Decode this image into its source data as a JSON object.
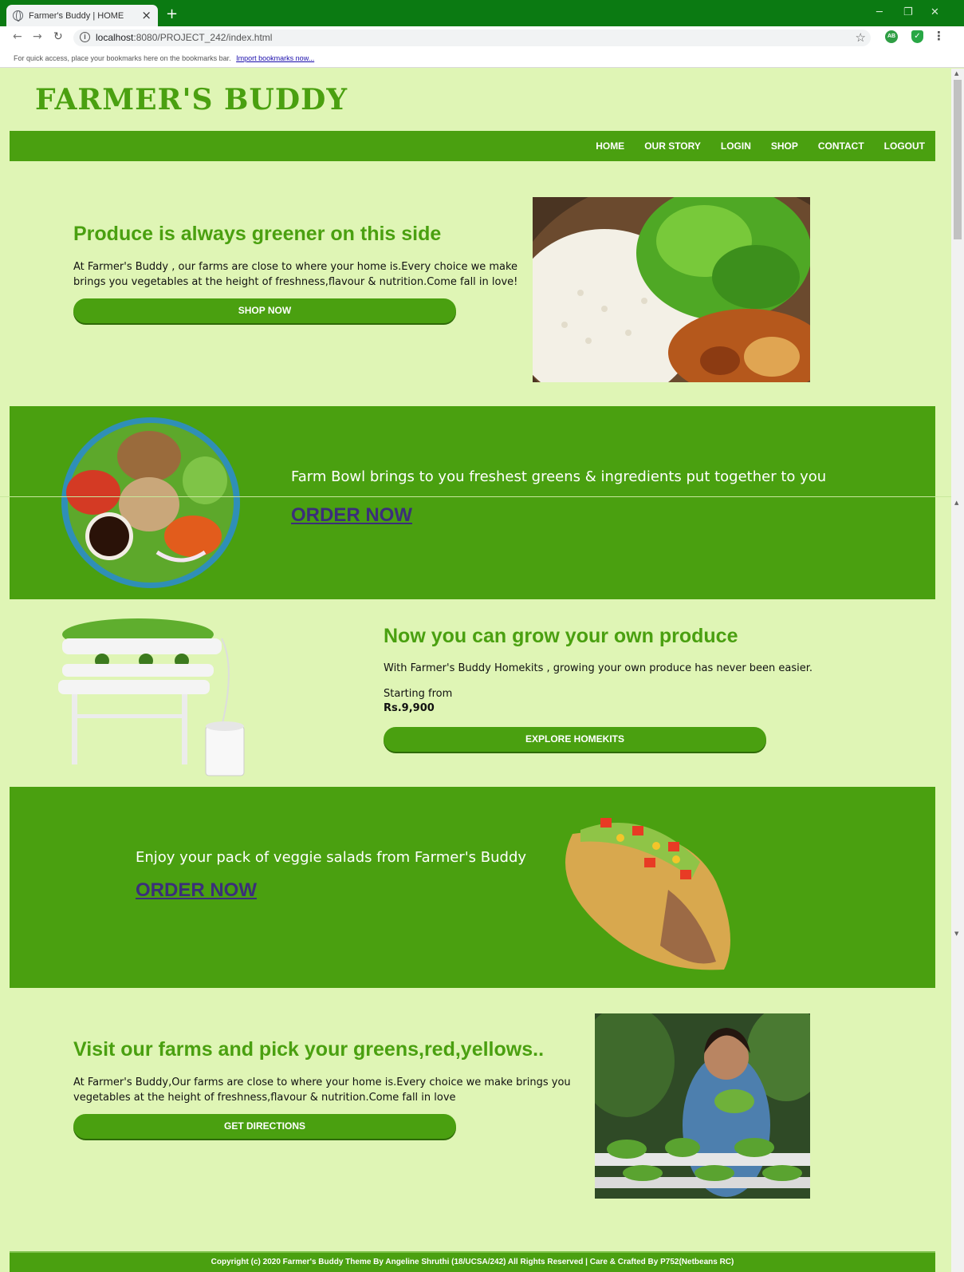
{
  "browser": {
    "tab_title": "Farmer's Buddy | HOME",
    "url_host": "localhost",
    "url_rest": ":8080/PROJECT_242/index.html",
    "bookmarks_text": "For quick access, place your bookmarks here on the bookmarks bar.",
    "bookmarks_link": "Import bookmarks now...",
    "ext1_label": "AB",
    "ext2_label": "✓"
  },
  "site": {
    "logo": "FARMER'S BUDDY",
    "nav": [
      "HOME",
      "OUR STORY",
      "LOGIN",
      "SHOP",
      "CONTACT",
      "LOGOUT"
    ]
  },
  "hero": {
    "heading": "Produce is always greener on this side",
    "text": "At Farmer's Buddy , our farms are close to where your home is.Every choice we make brings you vegetables at the height of freshness,flavour & nutrition.Come fall in love!",
    "button": "SHOP NOW"
  },
  "farm_bowl": {
    "text": "Farm Bowl brings to you freshest greens & ingredients put together to you",
    "link": "ORDER NOW"
  },
  "homekits": {
    "heading": "Now you can grow your own produce",
    "text": "With Farmer's Buddy Homekits , growing your own produce has never been easier.",
    "starting": "Starting from",
    "price": "Rs.9,900",
    "button": "EXPLORE HOMEKITS"
  },
  "salads": {
    "text": "Enjoy your pack of veggie salads from Farmer's Buddy",
    "link": "ORDER NOW"
  },
  "farms": {
    "heading": "Visit our farms and pick your greens,red,yellows..",
    "text": "At Farmer's Buddy,Our farms are close to where your home is.Every choice we make brings you vegetables at the height of freshness,flavour & nutrition.Come fall in love",
    "button": "GET DIRECTIONS"
  },
  "footer": {
    "text": "Copyright (c) 2020 Farmer's Buddy Theme By Angeline Shruthi (18/UCSA/242) All Rights Reserved | Care & Crafted By P752(Netbeans RC)"
  },
  "colors": {
    "brand_green": "#4aa010",
    "page_bg": "#dff5b5",
    "browser_green": "#0b7a12",
    "link_purple": "#3b2f7a"
  }
}
